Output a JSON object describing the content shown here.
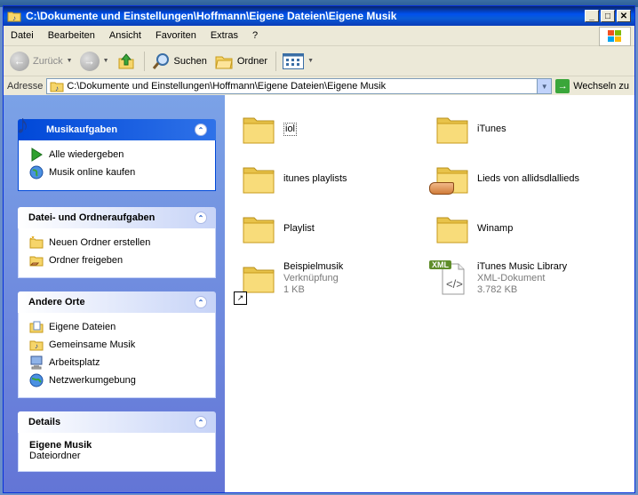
{
  "window": {
    "title": "C:\\Dokumente und Einstellungen\\Hoffmann\\Eigene Dateien\\Eigene Musik",
    "controls": {
      "minimize": "_",
      "maximize": "□",
      "close": "✕"
    }
  },
  "menu": [
    "Datei",
    "Bearbeiten",
    "Ansicht",
    "Favoriten",
    "Extras",
    "?"
  ],
  "toolbar": {
    "back_label": "Zurück",
    "search_label": "Suchen",
    "folders_label": "Ordner"
  },
  "address": {
    "label": "Adresse",
    "value": "C:\\Dokumente und Einstellungen\\Hoffmann\\Eigene Dateien\\Eigene Musik",
    "go_label": "Wechseln zu"
  },
  "panels": {
    "music": {
      "title": "Musikaufgaben",
      "tasks": [
        "Alle wiedergeben",
        "Musik online kaufen"
      ]
    },
    "file": {
      "title": "Datei- und Ordneraufgaben",
      "tasks": [
        "Neuen Ordner erstellen",
        "Ordner freigeben"
      ]
    },
    "places": {
      "title": "Andere Orte",
      "items": [
        "Eigene Dateien",
        "Gemeinsame Musik",
        "Arbeitsplatz",
        "Netzwerkumgebung"
      ]
    },
    "details": {
      "title": "Details",
      "name": "Eigene Musik",
      "type": "Dateiordner"
    }
  },
  "files": [
    {
      "name": "iol",
      "kind": "folder"
    },
    {
      "name": "iTunes",
      "kind": "folder"
    },
    {
      "name": "itunes playlists",
      "kind": "folder"
    },
    {
      "name": "Lieds von allidsdlallieds",
      "kind": "shared-folder"
    },
    {
      "name": "Playlist",
      "kind": "folder"
    },
    {
      "name": "Winamp",
      "kind": "folder"
    },
    {
      "name": "Beispielmusik",
      "kind": "shortcut",
      "type": "Verknüpfung",
      "size": "1 KB"
    },
    {
      "name": "iTunes Music Library",
      "kind": "xml",
      "type": "XML-Dokument",
      "size": "3.782 KB",
      "badge": "XML"
    }
  ],
  "colors": {
    "titlebar": "#0050ee",
    "task_link": "#215dc6",
    "folder": "#f6d56a"
  }
}
